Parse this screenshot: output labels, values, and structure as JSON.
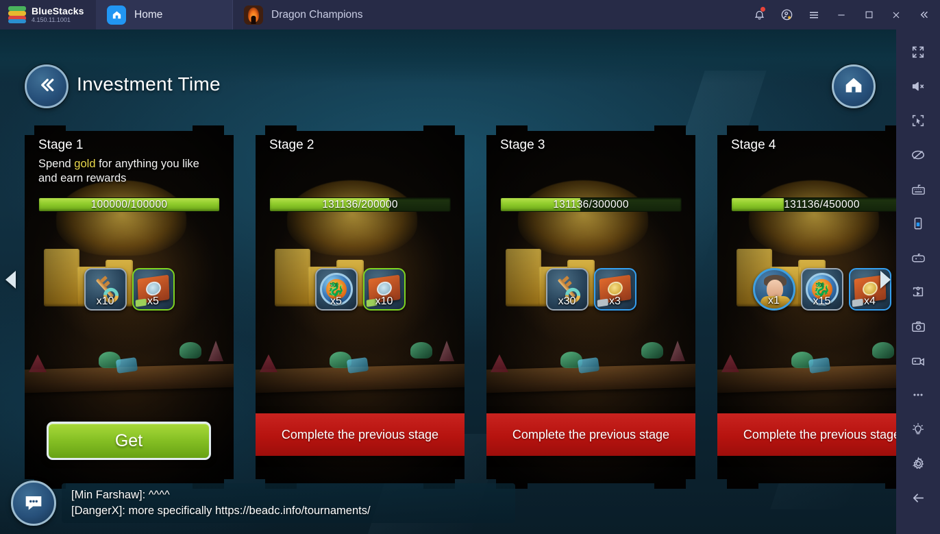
{
  "titlebar": {
    "brand_name": "BlueStacks",
    "brand_version": "4.150.11.1001",
    "tabs": [
      {
        "label": "Home",
        "icon": "home-icon",
        "active": true
      },
      {
        "label": "Dragon Champions",
        "icon": "game-icon",
        "active": false
      }
    ],
    "actions": [
      {
        "name": "notifications-icon",
        "has_badge": true
      },
      {
        "name": "account-star-icon",
        "has_badge": false
      },
      {
        "name": "hamburger-menu-icon",
        "has_badge": false
      },
      {
        "name": "minimize-icon",
        "has_badge": false
      },
      {
        "name": "maximize-icon",
        "has_badge": false
      },
      {
        "name": "close-icon",
        "has_badge": false
      },
      {
        "name": "collapse-chevrons-icon",
        "has_badge": false
      }
    ]
  },
  "sidebar": {
    "items": [
      {
        "name": "fullscreen-icon"
      },
      {
        "name": "mute-icon"
      },
      {
        "name": "screen-select-icon"
      },
      {
        "name": "ad-block-icon"
      },
      {
        "name": "keyboard-controls-icon"
      },
      {
        "name": "device-rotate-icon"
      },
      {
        "name": "gamepad-icon"
      },
      {
        "name": "macro-script-icon"
      },
      {
        "name": "screenshot-camera-icon"
      },
      {
        "name": "record-video-icon"
      },
      {
        "name": "more-options-icon"
      },
      {
        "name": "tips-lightbulb-icon"
      },
      {
        "name": "settings-gear-icon"
      },
      {
        "name": "back-arrow-icon"
      }
    ]
  },
  "game": {
    "header": {
      "title": "Investment Time",
      "back_icon": "double-chevron-left-icon",
      "home_icon": "home-house-icon"
    },
    "nav": {
      "left_arrow": "prev-arrow-icon",
      "right_arrow": "next-arrow-icon"
    },
    "stages": [
      {
        "title": "Stage 1",
        "description_prefix": "Spend ",
        "description_highlight": "gold",
        "description_suffix": " for anything you like and earn rewards",
        "progress_text": "100000/100000",
        "progress_current": 100000,
        "progress_max": 100000,
        "progress_percent": 100,
        "rewards": [
          {
            "item": "key",
            "qty": "x10",
            "frame": "gray",
            "shape": "square"
          },
          {
            "item": "book",
            "qty": "x5",
            "frame": "green",
            "shape": "square"
          }
        ],
        "button": {
          "label": "Get",
          "state": "claimable"
        }
      },
      {
        "title": "Stage 2",
        "description_prefix": "",
        "description_highlight": "",
        "description_suffix": "",
        "progress_text": "131136/200000",
        "progress_current": 131136,
        "progress_max": 200000,
        "progress_percent": 66,
        "rewards": [
          {
            "item": "medal",
            "qty": "x5",
            "frame": "gray",
            "shape": "square"
          },
          {
            "item": "book",
            "qty": "x10",
            "frame": "green",
            "shape": "square"
          }
        ],
        "button": {
          "label": "Complete the previous stage",
          "state": "locked"
        }
      },
      {
        "title": "Stage 3",
        "description_prefix": "",
        "description_highlight": "",
        "description_suffix": "",
        "progress_text": "131136/300000",
        "progress_current": 131136,
        "progress_max": 300000,
        "progress_percent": 44,
        "rewards": [
          {
            "item": "key",
            "qty": "x30",
            "frame": "gray",
            "shape": "square"
          },
          {
            "item": "book-gold",
            "qty": "x3",
            "frame": "blue",
            "shape": "square"
          }
        ],
        "button": {
          "label": "Complete the previous stage",
          "state": "locked"
        }
      },
      {
        "title": "Stage 4",
        "description_prefix": "",
        "description_highlight": "",
        "description_suffix": "",
        "progress_text": "131136/450000",
        "progress_current": 131136,
        "progress_max": 450000,
        "progress_percent": 29,
        "rewards": [
          {
            "item": "hero",
            "qty": "x1",
            "frame": "blue",
            "shape": "circle"
          },
          {
            "item": "medal",
            "qty": "x15",
            "frame": "gray",
            "shape": "square"
          },
          {
            "item": "book-gold",
            "qty": "x4",
            "frame": "blue",
            "shape": "square"
          }
        ],
        "button": {
          "label": "Complete the previous stage",
          "state": "locked"
        }
      }
    ],
    "chat": {
      "icon": "chat-bubble-icon",
      "lines": [
        "[Min Farshaw]: ^^^^",
        "[DangerX]: more specifically https://beadc.info/tournaments/"
      ]
    }
  },
  "colors": {
    "titlebar_bg": "#272b47",
    "accent_blue": "#2196f3",
    "progress_green": "#8fcb2b",
    "locked_red": "#b6130f",
    "gold_text": "#e9d84b"
  }
}
